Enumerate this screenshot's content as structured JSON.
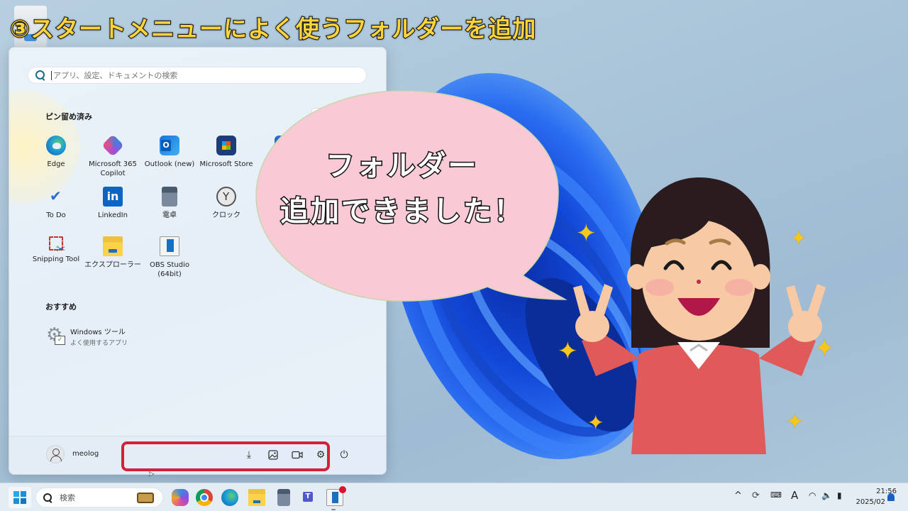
{
  "title": "③スタートメニューによく使うフォルダーを追加",
  "start_menu": {
    "search_placeholder": "アプリ、設定、ドキュメントの検索",
    "pinned_title": "ピン留め済み",
    "pinned_apps": [
      {
        "label": "Edge",
        "icon": "edge-icon"
      },
      {
        "label": "Microsoft 365\nCopilot",
        "icon": "m365-copilot-icon"
      },
      {
        "label": "Outlook (new)",
        "icon": "outlook-icon"
      },
      {
        "label": "Microsoft Store",
        "icon": "store-icon"
      },
      {
        "label": "To Do",
        "icon": "todo-icon"
      },
      {
        "label": "LinkedIn",
        "icon": "linkedin-icon"
      },
      {
        "label": "電卓",
        "icon": "calculator-icon"
      },
      {
        "label": "クロック",
        "icon": "clock-icon"
      },
      {
        "label": "Snipping Tool",
        "icon": "snipping-tool-icon"
      },
      {
        "label": "エクスプローラー",
        "icon": "file-explorer-icon"
      },
      {
        "label": "OBS Studio\n(64bit)",
        "icon": "obs-icon"
      }
    ],
    "linkedin_glyph": "in",
    "recommended_title": "おすすめ",
    "recommended": [
      {
        "name": "Windows ツール",
        "subtitle": "よく使用するアプリ",
        "icon": "windows-tools-icon"
      }
    ],
    "user_name": "meolog",
    "quick_folders": [
      {
        "name": "downloads",
        "glyph": "⤓",
        "icon": "download-icon"
      },
      {
        "name": "pictures",
        "glyph": "🖼",
        "icon": "pictures-icon"
      },
      {
        "name": "videos",
        "glyph": "▭",
        "icon": "video-icon"
      },
      {
        "name": "settings",
        "glyph": "⚙",
        "icon": "gear-icon"
      }
    ],
    "power_glyph": "⏻"
  },
  "bubble_text": "フォルダー\n追加できました！",
  "highlight_color": "#d4203a",
  "taskbar": {
    "search_placeholder": "検索",
    "apps": [
      "copilot",
      "chrome",
      "edge",
      "file-explorer",
      "calculator",
      "teams",
      "obs-studio"
    ],
    "tray": {
      "chevron": "^",
      "ime": "A",
      "time": "21:56",
      "date": "2025/02"
    }
  }
}
